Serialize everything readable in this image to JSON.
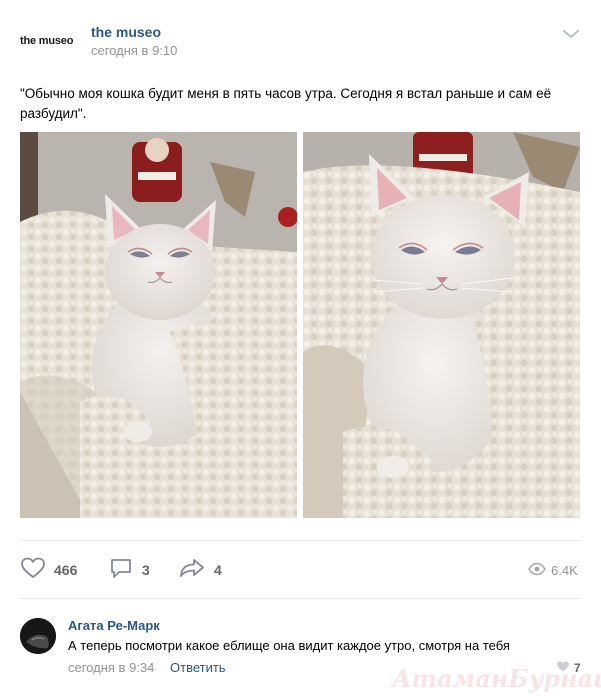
{
  "post": {
    "group_logo_text": "the museo",
    "group_name": "the museo",
    "time": "сегодня в 9:10",
    "text": "\"Обычно моя кошка будит меня в пять часов утра. Сегодня я встал раньше и сам её разбудил\".",
    "photos": [
      {
        "subject": "white kitten wrapped in blanket, sleepy"
      },
      {
        "subject": "white kitten wrapped in blanket, close-up"
      }
    ]
  },
  "actions": {
    "likes": "466",
    "comments": "3",
    "shares": "4",
    "views": "6.4K"
  },
  "comment": {
    "author": "Агата Ре-Марк",
    "text": "А теперь посмотри какое еблище она видит каждое утро, смотря на тебя",
    "date": "сегодня в 9:34",
    "reply_label": "Ответить",
    "likes": "7"
  },
  "watermark": "АтаманБурнаш для ЯП",
  "colors": {
    "link": "#2a5885",
    "muted": "#939393",
    "icon": "#828a99",
    "divider": "#e7e8ec"
  }
}
